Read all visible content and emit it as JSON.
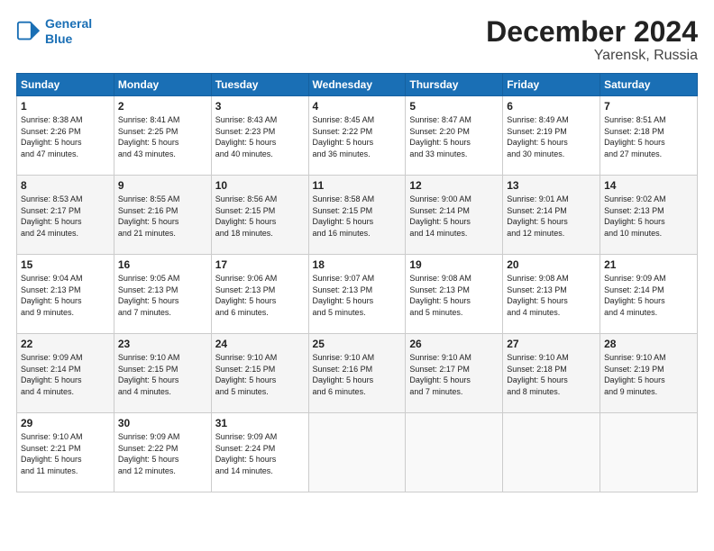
{
  "logo": {
    "line1": "General",
    "line2": "Blue"
  },
  "header": {
    "title": "December 2024",
    "subtitle": "Yarensk, Russia"
  },
  "weekdays": [
    "Sunday",
    "Monday",
    "Tuesday",
    "Wednesday",
    "Thursday",
    "Friday",
    "Saturday"
  ],
  "weeks": [
    [
      {
        "day": "1",
        "info": "Sunrise: 8:38 AM\nSunset: 2:26 PM\nDaylight: 5 hours\nand 47 minutes."
      },
      {
        "day": "2",
        "info": "Sunrise: 8:41 AM\nSunset: 2:25 PM\nDaylight: 5 hours\nand 43 minutes."
      },
      {
        "day": "3",
        "info": "Sunrise: 8:43 AM\nSunset: 2:23 PM\nDaylight: 5 hours\nand 40 minutes."
      },
      {
        "day": "4",
        "info": "Sunrise: 8:45 AM\nSunset: 2:22 PM\nDaylight: 5 hours\nand 36 minutes."
      },
      {
        "day": "5",
        "info": "Sunrise: 8:47 AM\nSunset: 2:20 PM\nDaylight: 5 hours\nand 33 minutes."
      },
      {
        "day": "6",
        "info": "Sunrise: 8:49 AM\nSunset: 2:19 PM\nDaylight: 5 hours\nand 30 minutes."
      },
      {
        "day": "7",
        "info": "Sunrise: 8:51 AM\nSunset: 2:18 PM\nDaylight: 5 hours\nand 27 minutes."
      }
    ],
    [
      {
        "day": "8",
        "info": "Sunrise: 8:53 AM\nSunset: 2:17 PM\nDaylight: 5 hours\nand 24 minutes."
      },
      {
        "day": "9",
        "info": "Sunrise: 8:55 AM\nSunset: 2:16 PM\nDaylight: 5 hours\nand 21 minutes."
      },
      {
        "day": "10",
        "info": "Sunrise: 8:56 AM\nSunset: 2:15 PM\nDaylight: 5 hours\nand 18 minutes."
      },
      {
        "day": "11",
        "info": "Sunrise: 8:58 AM\nSunset: 2:15 PM\nDaylight: 5 hours\nand 16 minutes."
      },
      {
        "day": "12",
        "info": "Sunrise: 9:00 AM\nSunset: 2:14 PM\nDaylight: 5 hours\nand 14 minutes."
      },
      {
        "day": "13",
        "info": "Sunrise: 9:01 AM\nSunset: 2:14 PM\nDaylight: 5 hours\nand 12 minutes."
      },
      {
        "day": "14",
        "info": "Sunrise: 9:02 AM\nSunset: 2:13 PM\nDaylight: 5 hours\nand 10 minutes."
      }
    ],
    [
      {
        "day": "15",
        "info": "Sunrise: 9:04 AM\nSunset: 2:13 PM\nDaylight: 5 hours\nand 9 minutes."
      },
      {
        "day": "16",
        "info": "Sunrise: 9:05 AM\nSunset: 2:13 PM\nDaylight: 5 hours\nand 7 minutes."
      },
      {
        "day": "17",
        "info": "Sunrise: 9:06 AM\nSunset: 2:13 PM\nDaylight: 5 hours\nand 6 minutes."
      },
      {
        "day": "18",
        "info": "Sunrise: 9:07 AM\nSunset: 2:13 PM\nDaylight: 5 hours\nand 5 minutes."
      },
      {
        "day": "19",
        "info": "Sunrise: 9:08 AM\nSunset: 2:13 PM\nDaylight: 5 hours\nand 5 minutes."
      },
      {
        "day": "20",
        "info": "Sunrise: 9:08 AM\nSunset: 2:13 PM\nDaylight: 5 hours\nand 4 minutes."
      },
      {
        "day": "21",
        "info": "Sunrise: 9:09 AM\nSunset: 2:14 PM\nDaylight: 5 hours\nand 4 minutes."
      }
    ],
    [
      {
        "day": "22",
        "info": "Sunrise: 9:09 AM\nSunset: 2:14 PM\nDaylight: 5 hours\nand 4 minutes."
      },
      {
        "day": "23",
        "info": "Sunrise: 9:10 AM\nSunset: 2:15 PM\nDaylight: 5 hours\nand 4 minutes."
      },
      {
        "day": "24",
        "info": "Sunrise: 9:10 AM\nSunset: 2:15 PM\nDaylight: 5 hours\nand 5 minutes."
      },
      {
        "day": "25",
        "info": "Sunrise: 9:10 AM\nSunset: 2:16 PM\nDaylight: 5 hours\nand 6 minutes."
      },
      {
        "day": "26",
        "info": "Sunrise: 9:10 AM\nSunset: 2:17 PM\nDaylight: 5 hours\nand 7 minutes."
      },
      {
        "day": "27",
        "info": "Sunrise: 9:10 AM\nSunset: 2:18 PM\nDaylight: 5 hours\nand 8 minutes."
      },
      {
        "day": "28",
        "info": "Sunrise: 9:10 AM\nSunset: 2:19 PM\nDaylight: 5 hours\nand 9 minutes."
      }
    ],
    [
      {
        "day": "29",
        "info": "Sunrise: 9:10 AM\nSunset: 2:21 PM\nDaylight: 5 hours\nand 11 minutes."
      },
      {
        "day": "30",
        "info": "Sunrise: 9:09 AM\nSunset: 2:22 PM\nDaylight: 5 hours\nand 12 minutes."
      },
      {
        "day": "31",
        "info": "Sunrise: 9:09 AM\nSunset: 2:24 PM\nDaylight: 5 hours\nand 14 minutes."
      },
      {
        "day": "",
        "info": ""
      },
      {
        "day": "",
        "info": ""
      },
      {
        "day": "",
        "info": ""
      },
      {
        "day": "",
        "info": ""
      }
    ]
  ]
}
